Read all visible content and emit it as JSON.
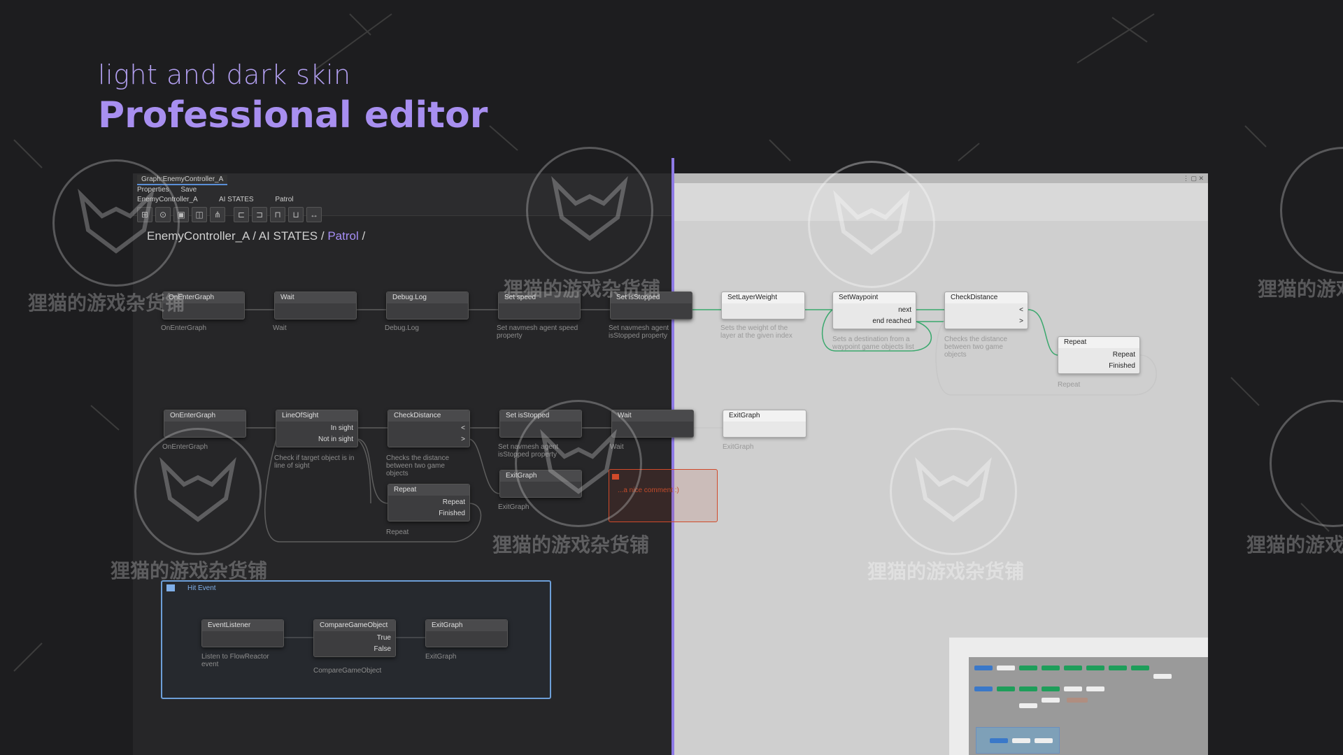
{
  "hero": {
    "subtitle": "light and dark skin",
    "title": "Professional editor"
  },
  "window": {
    "title": "Graph:EnemyController_A",
    "menu": [
      "Properties",
      "Save"
    ],
    "tabs": [
      "EnemyController_A",
      "AI STATES",
      "Patrol"
    ]
  },
  "breadcrumb": {
    "root": "EnemyController_A",
    "mid": "AI STATES",
    "active": "Patrol",
    "sep": "/"
  },
  "nodes_dark_row1": [
    {
      "title": "OnEnterGraph",
      "label": "OnEnterGraph"
    },
    {
      "title": "Wait",
      "label": "Wait"
    },
    {
      "title": "Debug.Log",
      "label": "Debug.Log"
    },
    {
      "title": "Set speed",
      "label": "Set navmesh agent speed property"
    },
    {
      "title": "Set isStopped",
      "label": "Set navmesh agent isStopped property"
    }
  ],
  "nodes_light_row1": [
    {
      "title": "SetLayerWeight",
      "label": "Sets the weight of the layer at the given index"
    },
    {
      "title": "SetWaypoint",
      "label": "Sets a destination from a waypoint game objects list",
      "port1": "next",
      "port2": "end reached"
    },
    {
      "title": "CheckDistance",
      "label": "Checks the distance between two game objects",
      "port1": "<",
      "port2": ">"
    },
    {
      "title": "Repeat",
      "label": "Repeat",
      "port1": "Repeat",
      "port2": "Finished"
    }
  ],
  "nodes_dark_row2": [
    {
      "title": "OnEnterGraph",
      "label": "OnEnterGraph"
    },
    {
      "title": "LineOfSight",
      "label": "Check if target object is in line of sight",
      "port1": "In sight",
      "port2": "Not in sight"
    },
    {
      "title": "CheckDistance",
      "label": "Checks the distance between two game objects",
      "port1": "<",
      "port2": ">"
    },
    {
      "title": "Set isStopped",
      "label": "Set navmesh agent isStopped property"
    },
    {
      "title": "Wait",
      "label": "Wait"
    }
  ],
  "node_exit_light": {
    "title": "ExitGraph",
    "label": "ExitGraph"
  },
  "node_repeat_dark": {
    "title": "Repeat",
    "label": "Repeat",
    "port1": "Repeat",
    "port2": "Finished"
  },
  "node_exit_dark": {
    "title": "ExitGraph",
    "label": "ExitGraph"
  },
  "comment": {
    "text": "...a nice comment :)"
  },
  "group": {
    "title": "Hit Event",
    "nodes": [
      {
        "title": "EventListener",
        "label": "Listen to FlowReactor event"
      },
      {
        "title": "CompareGameObject",
        "label": "CompareGameObject",
        "port1": "True",
        "port2": "False"
      },
      {
        "title": "ExitGraph",
        "label": "ExitGraph"
      }
    ]
  },
  "watermark": {
    "text": "狸猫的游戏杂货铺"
  },
  "colors": {
    "accent": "#a88ff0",
    "wire_dark": "#5a5a5a",
    "wire_light": "#34a36a",
    "group": "#6d9fd8",
    "comment": "#d04a2a"
  }
}
